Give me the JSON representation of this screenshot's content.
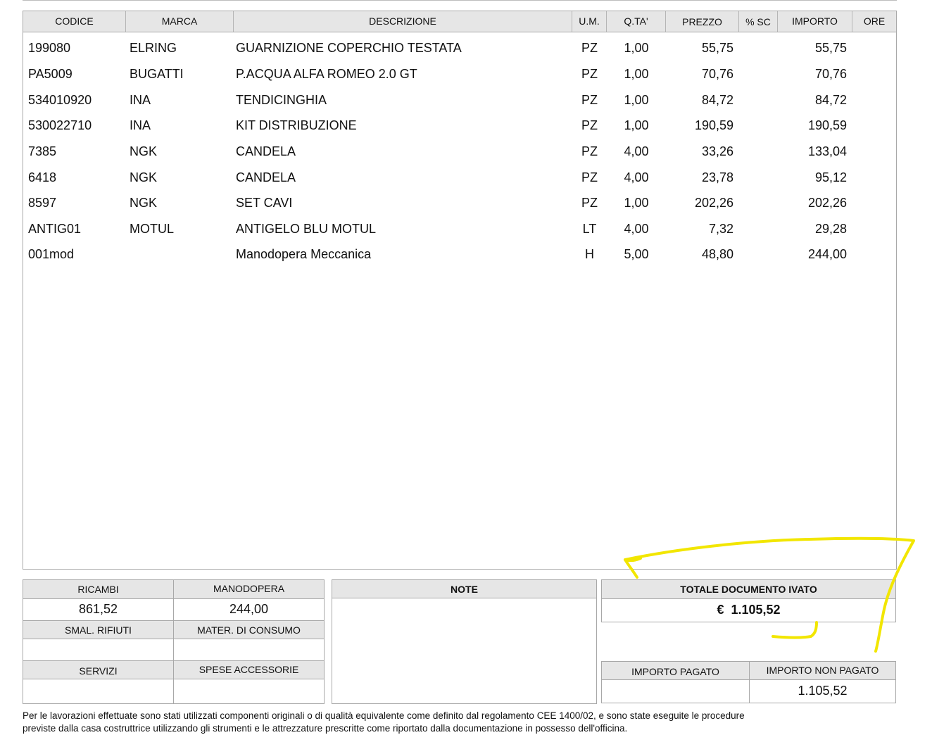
{
  "table": {
    "headers": {
      "codice": "CODICE",
      "marca": "MARCA",
      "descrizione": "DESCRIZIONE",
      "um": "U.M.",
      "qta": "Q.TA'",
      "prezzo": "PREZZO",
      "sc": "% SC",
      "importo": "IMPORTO",
      "ore": "ORE"
    },
    "rows": [
      {
        "codice": "199080",
        "marca": "ELRING",
        "descrizione": "GUARNIZIONE COPERCHIO TESTATA",
        "um": "PZ",
        "qta": "1,00",
        "prezzo": "55,75",
        "sc": "",
        "importo": "55,75",
        "ore": ""
      },
      {
        "codice": "PA5009",
        "marca": "BUGATTI",
        "descrizione": "P.ACQUA ALFA ROMEO 2.0 GT",
        "um": "PZ",
        "qta": "1,00",
        "prezzo": "70,76",
        "sc": "",
        "importo": "70,76",
        "ore": ""
      },
      {
        "codice": "534010920",
        "marca": "INA",
        "descrizione": "TENDICINGHIA",
        "um": "PZ",
        "qta": "1,00",
        "prezzo": "84,72",
        "sc": "",
        "importo": "84,72",
        "ore": ""
      },
      {
        "codice": "530022710",
        "marca": "INA",
        "descrizione": "KIT DISTRIBUZIONE",
        "um": "PZ",
        "qta": "1,00",
        "prezzo": "190,59",
        "sc": "",
        "importo": "190,59",
        "ore": ""
      },
      {
        "codice": "7385",
        "marca": "NGK",
        "descrizione": "CANDELA",
        "um": "PZ",
        "qta": "4,00",
        "prezzo": "33,26",
        "sc": "",
        "importo": "133,04",
        "ore": ""
      },
      {
        "codice": "6418",
        "marca": "NGK",
        "descrizione": "CANDELA",
        "um": "PZ",
        "qta": "4,00",
        "prezzo": "23,78",
        "sc": "",
        "importo": "95,12",
        "ore": ""
      },
      {
        "codice": "8597",
        "marca": "NGK",
        "descrizione": "SET CAVI",
        "um": "PZ",
        "qta": "1,00",
        "prezzo": "202,26",
        "sc": "",
        "importo": "202,26",
        "ore": ""
      },
      {
        "codice": "ANTIG01",
        "marca": "MOTUL",
        "descrizione": "ANTIGELO BLU MOTUL",
        "um": "LT",
        "qta": "4,00",
        "prezzo": "7,32",
        "sc": "",
        "importo": "29,28",
        "ore": ""
      },
      {
        "codice": "001mod",
        "marca": "",
        "descrizione": "Manodopera Meccanica",
        "um": "H",
        "qta": "5,00",
        "prezzo": "48,80",
        "sc": "",
        "importo": "244,00",
        "ore": ""
      }
    ]
  },
  "summary": {
    "ricambi_label": "RICAMBI",
    "ricambi_value": "861,52",
    "manodopera_label": "MANODOPERA",
    "manodopera_value": "244,00",
    "smal_rifiuti_label": "SMAL. RIFIUTI",
    "smal_rifiuti_value": "",
    "mater_consumo_label": "MATER. DI CONSUMO",
    "mater_consumo_value": "",
    "servizi_label": "SERVIZI",
    "servizi_value": "",
    "spese_accessorie_label": "SPESE ACCESSORIE",
    "spese_accessorie_value": ""
  },
  "note": {
    "label": "NOTE",
    "text": ""
  },
  "totale": {
    "label": "TOTALE DOCUMENTO IVATO",
    "currency": "€",
    "value": "1.105,52"
  },
  "pagamento": {
    "pagato_label": "IMPORTO PAGATO",
    "pagato_value": "",
    "non_pagato_label": "IMPORTO NON PAGATO",
    "non_pagato_value": "1.105,52"
  },
  "footer": {
    "line1": "Per le lavorazioni effettuate sono stati utilizzati componenti originali o di qualità equivalente come definito dal regolamento CEE 1400/02, e sono state eseguite le procedure",
    "line2": "previste dalla casa costruttrice utilizzando gli strumenti e le attrezzature prescritte come riportato dalla documentazione in possesso dell'officina."
  },
  "colors": {
    "header_bg": "#e6e6e6",
    "border": "#a8a8a8",
    "highlight": "#f2e600"
  }
}
